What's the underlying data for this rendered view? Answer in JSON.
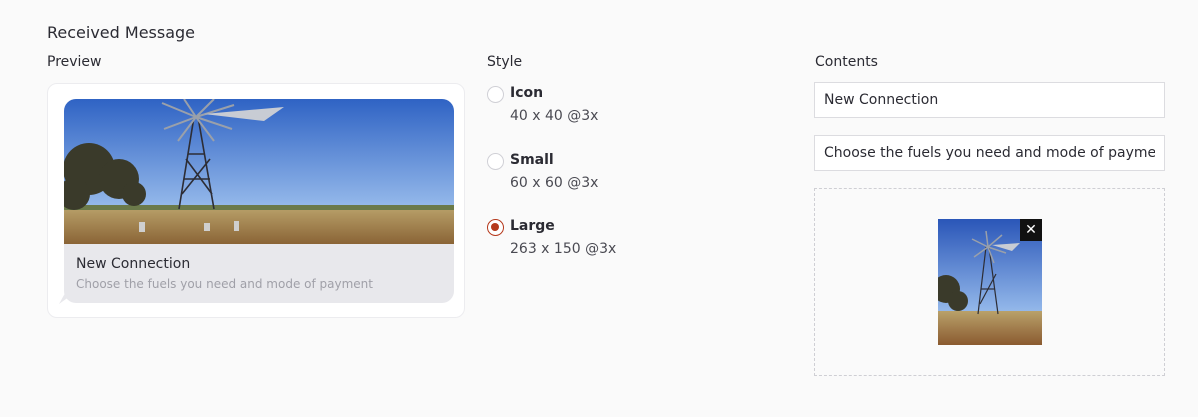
{
  "header": {
    "title": "Received Message"
  },
  "preview": {
    "label": "Preview",
    "message_title": "New Connection",
    "message_subtitle": "Choose the fuels you need and mode of payment",
    "image": "windmill-landscape"
  },
  "style": {
    "label": "Style",
    "selected": "Large",
    "options": [
      {
        "name": "Icon",
        "size": "40 x 40 @3x",
        "checked": false
      },
      {
        "name": "Small",
        "size": "60 x 60 @3x",
        "checked": false
      },
      {
        "name": "Large",
        "size": "263 x 150 @3x",
        "checked": true
      }
    ],
    "accent_color": "#b5391c"
  },
  "contents": {
    "label": "Contents",
    "title_value": "New Connection",
    "subtitle_value": "Choose the fuels you need and mode of payment",
    "image_remove_icon": "close-icon"
  }
}
